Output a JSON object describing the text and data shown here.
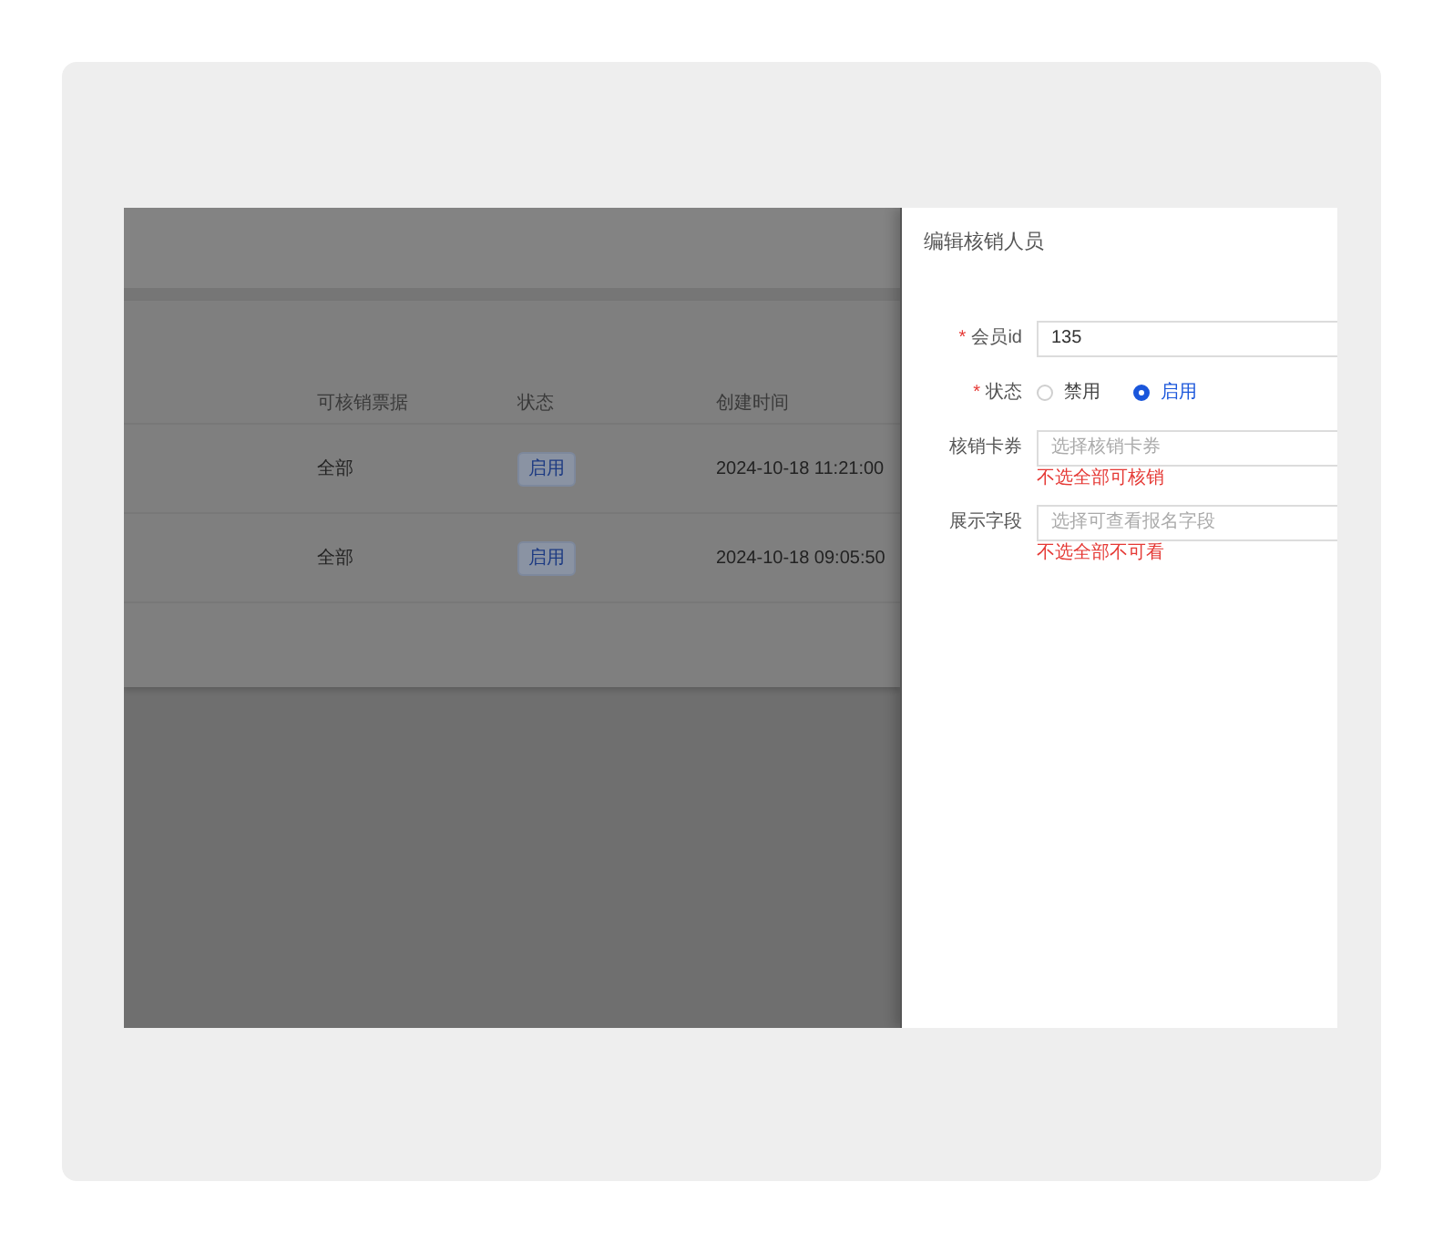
{
  "table": {
    "columns": [
      "可核销票据",
      "状态",
      "创建时间"
    ],
    "rows": [
      {
        "tickets": "全部",
        "status": "启用",
        "created": "2024-10-18 11:21:00"
      },
      {
        "tickets": "全部",
        "status": "启用",
        "created": "2024-10-18 09:05:50"
      }
    ]
  },
  "drawer": {
    "title": "编辑核销人员",
    "fields": [
      {
        "kind": "text",
        "required_mark": "*",
        "label": "会员id",
        "value": "135"
      },
      {
        "kind": "radio",
        "required_mark": "*",
        "label": "状态",
        "options": [
          {
            "label": "禁用",
            "selected": false
          },
          {
            "label": "启用",
            "selected": true
          }
        ]
      },
      {
        "kind": "select",
        "label": "核销卡券",
        "placeholder": "选择核销卡券",
        "hint": "不选全部可核销"
      },
      {
        "kind": "select",
        "label": "展示字段",
        "placeholder": "选择可查看报名字段",
        "hint": "不选全部不可看"
      }
    ]
  }
}
